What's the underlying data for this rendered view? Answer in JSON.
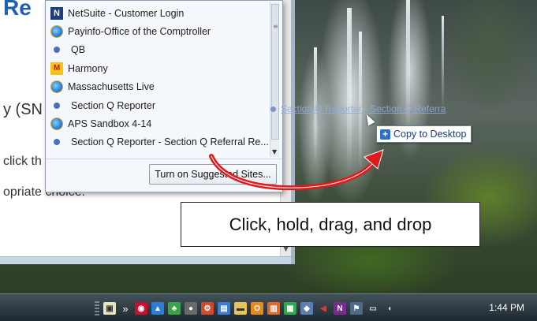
{
  "jumplist": {
    "items": [
      {
        "label": "NetSuite - Customer Login",
        "icon": "netsuite-icon"
      },
      {
        "label": "Payinfo-Office of the Comptroller",
        "icon": "ie-icon"
      },
      {
        "label": "QB",
        "icon": "dot-icon"
      },
      {
        "label": "Harmony",
        "icon": "harmony-icon"
      },
      {
        "label": "Massachusetts Live",
        "icon": "ie-icon"
      },
      {
        "label": "Section Q Reporter",
        "icon": "dot-icon"
      },
      {
        "label": "APS Sandbox 4-14",
        "icon": "ie-icon"
      },
      {
        "label": "Section Q Reporter - Section Q Referral Re...",
        "icon": "dot-icon"
      }
    ],
    "footer_button": "Turn on Suggested Sites..."
  },
  "browser_bg": {
    "title_fragment": "Re",
    "line1": "y (SN",
    "line2": "click th",
    "line3": "opriate choice."
  },
  "drag": {
    "ghost_text": "Section Q Reporter - Section Q Referra",
    "copy_label": "Copy to Desktop"
  },
  "callout": {
    "text": "Click, hold, drag, and drop"
  },
  "taskbar": {
    "chevron": "»",
    "clock": "1:44 PM"
  },
  "colors": {
    "arrow": "#e0191b",
    "accent": "#2b71c9"
  }
}
